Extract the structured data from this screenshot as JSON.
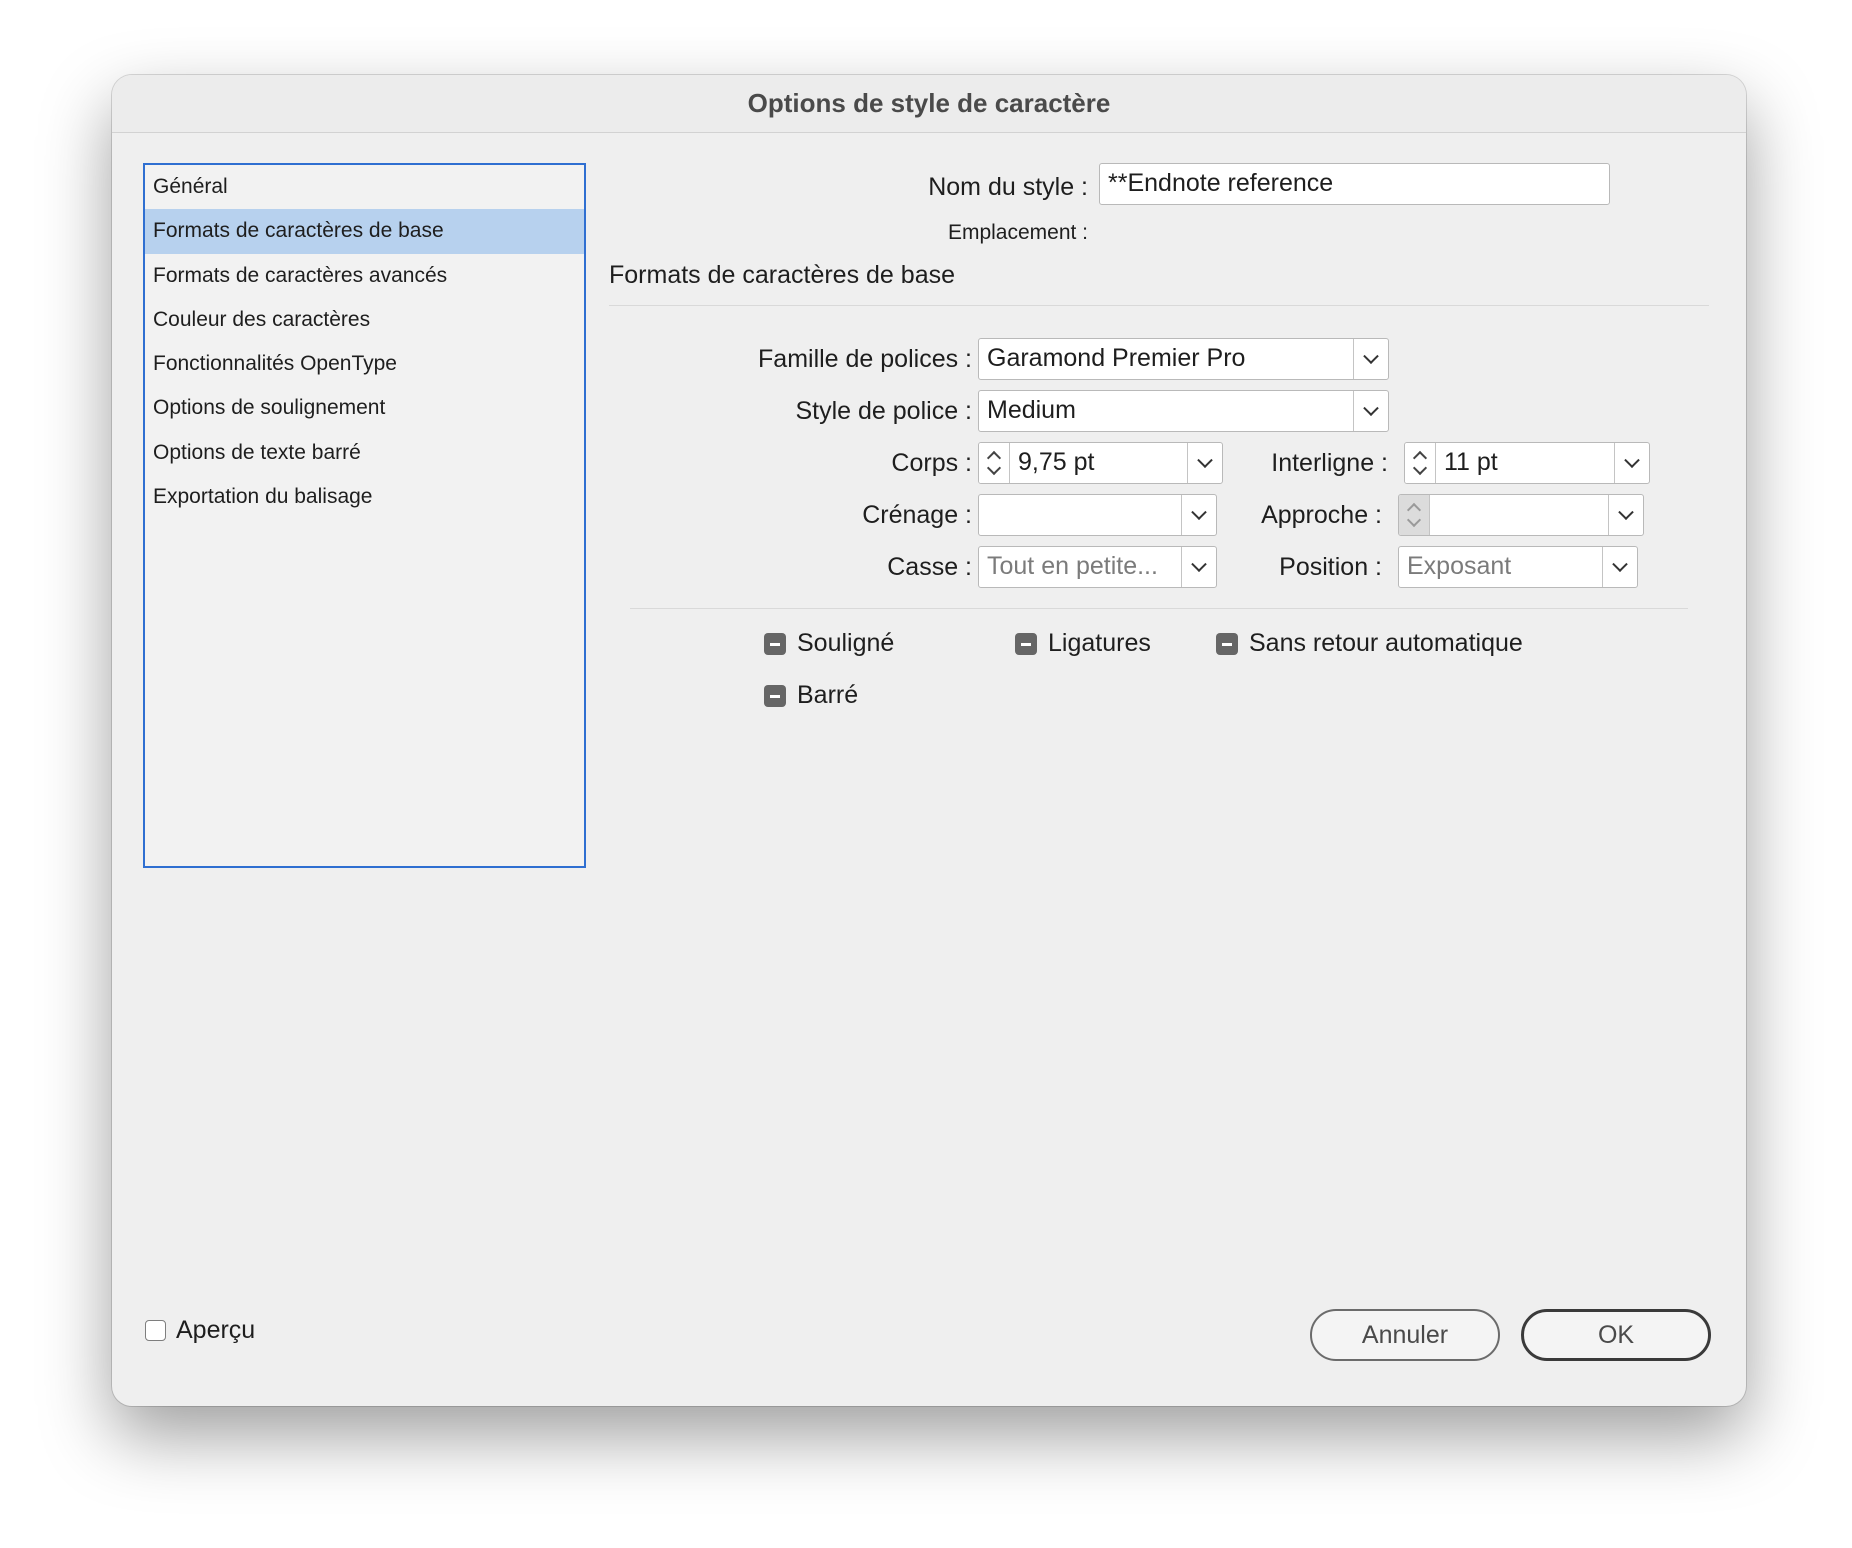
{
  "dialog": {
    "title": "Options de style de caractère"
  },
  "sidebar": {
    "items": [
      {
        "label": "Général",
        "selected": false
      },
      {
        "label": "Formats de caractères de base",
        "selected": true
      },
      {
        "label": "Formats de caractères avancés",
        "selected": false
      },
      {
        "label": "Couleur des caractères",
        "selected": false
      },
      {
        "label": "Fonctionnalités OpenType",
        "selected": false
      },
      {
        "label": "Options de soulignement",
        "selected": false
      },
      {
        "label": "Options de texte barré",
        "selected": false
      },
      {
        "label": "Exportation du balisage",
        "selected": false
      }
    ]
  },
  "header": {
    "style_name_label": "Nom du style :",
    "style_name_value": "**Endnote reference",
    "location_label": "Emplacement :"
  },
  "section": {
    "title": "Formats de caractères de base"
  },
  "fields": {
    "font_family": {
      "label": "Famille de polices :",
      "value": "Garamond Premier Pro"
    },
    "font_style": {
      "label": "Style de police :",
      "value": "Medium"
    },
    "size": {
      "label": "Corps :",
      "value": "9,75 pt"
    },
    "leading": {
      "label": "Interligne :",
      "value": "11 pt"
    },
    "kerning": {
      "label": "Crénage :",
      "value": ""
    },
    "tracking": {
      "label": "Approche :",
      "value": ""
    },
    "case": {
      "label": "Casse :",
      "value": "Tout en petite..."
    },
    "position": {
      "label": "Position :",
      "value": "Exposant"
    }
  },
  "checkboxes": {
    "underline": {
      "label": "Souligné",
      "state": "mixed"
    },
    "ligatures": {
      "label": "Ligatures",
      "state": "mixed"
    },
    "no_break": {
      "label": "Sans retour automatique",
      "state": "mixed"
    },
    "strikethrough": {
      "label": "Barré",
      "state": "mixed"
    }
  },
  "footer": {
    "preview_label": "Aperçu",
    "preview_checked": false,
    "cancel_label": "Annuler",
    "ok_label": "OK"
  },
  "colors": {
    "selection": "#b7d1ee",
    "focus_ring": "#2f6fd1"
  }
}
